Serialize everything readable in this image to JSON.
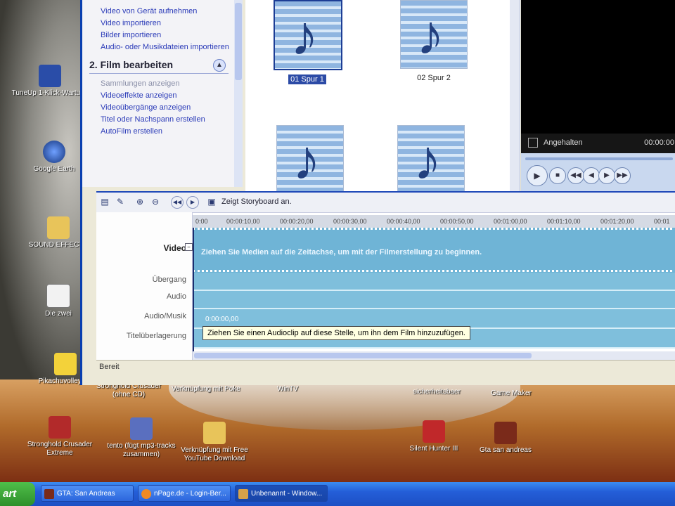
{
  "tasks": {
    "import_links": [
      "Video von Gerät aufnehmen",
      "Video importieren",
      "Bilder importieren",
      "Audio- oder Musikdateien importieren"
    ],
    "section_title": "2. Film bearbeiten",
    "edit_links": [
      "Sammlungen anzeigen",
      "Videoeffekte anzeigen",
      "Videoübergänge anzeigen",
      "Titel oder Nachspann erstellen",
      "AutoFilm erstellen"
    ]
  },
  "collection": {
    "clips": [
      {
        "label": "01 Spur 1",
        "selected": true
      },
      {
        "label": "02 Spur 2",
        "selected": false
      },
      {
        "label": "",
        "selected": false
      },
      {
        "label": "",
        "selected": false
      }
    ]
  },
  "preview": {
    "status": "Angehalten",
    "time": "00:00:00"
  },
  "timeline": {
    "toolbar_label": "Zeigt Storyboard an.",
    "tracks": [
      "Video",
      "Übergang",
      "Audio",
      "Audio/Musik",
      "Titelüberlagerung"
    ],
    "ruler_ticks": [
      "0:00",
      "00:00:10,00",
      "00:00:20,00",
      "00:00:30,00",
      "00:00:40,00",
      "00:00:50,00",
      "00:01:00,00",
      "00:01:10,00",
      "00:01:20,00",
      "00:01"
    ],
    "video_hint": "Ziehen Sie Medien auf die Zeitachse, um mit der Filmerstellung zu beginnen.",
    "tooltip_time": "0:00:00,00",
    "tooltip_text": "Ziehen Sie einen Audioclip auf diese Stelle, um ihn dem Film hinzuzufügen."
  },
  "statusbar": {
    "text": "Bereit"
  },
  "desktop_icons": [
    "TuneUp 1-Klick-Wartung",
    "Google Earth",
    "SOUND EFFECTS",
    "Die zwei",
    "Pikachuvolleyball",
    "Stronghold Crusader (ohne CD)",
    "Verknüpfung mit Poke",
    "WinTV",
    "sicherheitsbaer",
    "Game Maker",
    "Stronghold Crusader Extreme",
    "tento (fügt mp3-tracks zusammen)",
    "Verknüpfung mit Free YouTube Download",
    "Silent Hunter III",
    "Gta san andreas"
  ],
  "taskbar": {
    "start": "art",
    "buttons": [
      "GTA: San Andreas",
      "nPage.de - Login-Ber...",
      "Unbenannt - Window..."
    ]
  }
}
